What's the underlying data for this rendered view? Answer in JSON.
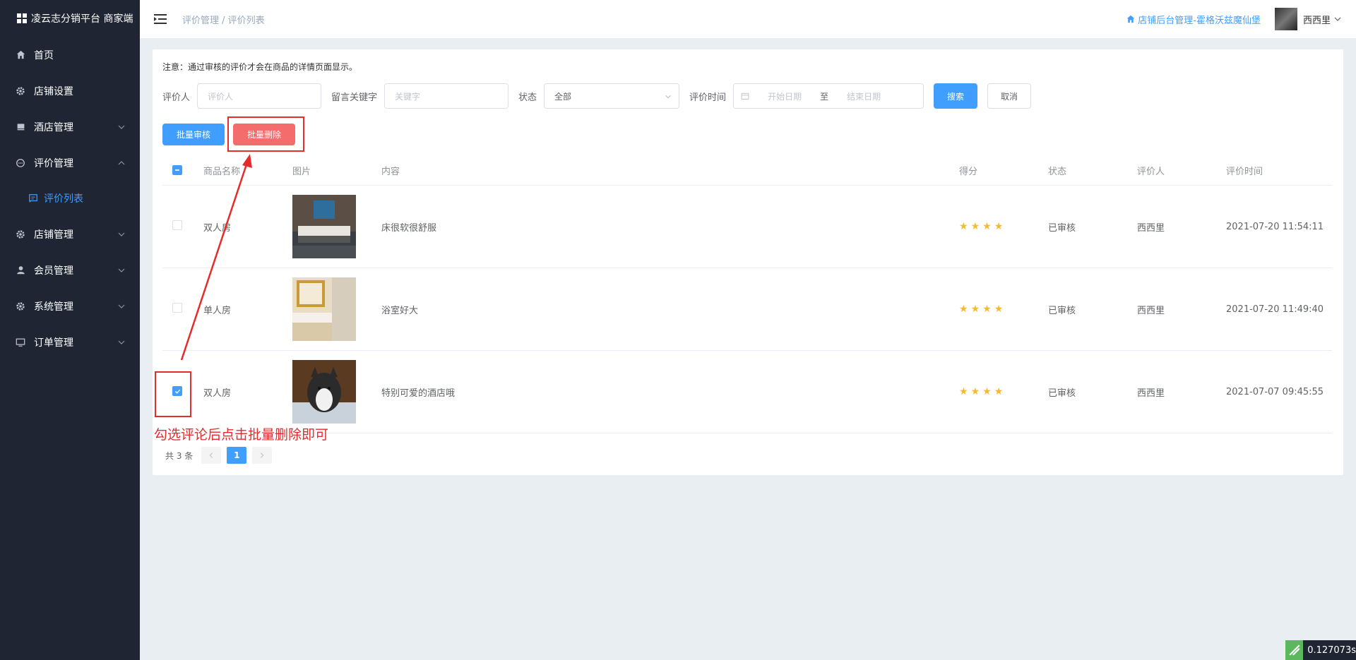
{
  "brand": {
    "title": "凌云志分销平台 商家端"
  },
  "sidebar": {
    "items": [
      {
        "label": "首页",
        "icon": "home-icon"
      },
      {
        "label": "店铺设置",
        "icon": "gear-icon"
      },
      {
        "label": "酒店管理",
        "icon": "bed-icon"
      },
      {
        "label": "评价管理",
        "icon": "comment-icon"
      },
      {
        "label": "评价列表",
        "icon": "comment-list-icon"
      },
      {
        "label": "店铺管理",
        "icon": "gear-icon"
      },
      {
        "label": "会员管理",
        "icon": "user-icon"
      },
      {
        "label": "系统管理",
        "icon": "gear-icon"
      },
      {
        "label": "订单管理",
        "icon": "monitor-icon"
      }
    ]
  },
  "header": {
    "breadcrumb": "评价管理 / 评价列表",
    "store_link": "店铺后台管理-霍格沃兹魔仙堡",
    "username": "西西里"
  },
  "notice": "注意：通过审核的评价才会在商品的详情页面显示。",
  "filters": {
    "reviewer_label": "评价人",
    "reviewer_placeholder": "评价人",
    "keyword_label": "留言关键字",
    "keyword_placeholder": "关键字",
    "status_label": "状态",
    "status_value": "全部",
    "time_label": "评价时间",
    "start_placeholder": "开始日期",
    "range_sep": "至",
    "end_placeholder": "结束日期",
    "search_label": "搜索",
    "cancel_label": "取消"
  },
  "batch": {
    "approve_label": "批量审核",
    "delete_label": "批量删除"
  },
  "table": {
    "headers": {
      "name": "商品名称",
      "image": "图片",
      "content": "内容",
      "score": "得分",
      "status": "状态",
      "reviewer": "评价人",
      "time": "评价时间"
    },
    "rows": [
      {
        "name": "双人房",
        "content": "床很软很舒服",
        "rating": 4,
        "status": "已审核",
        "reviewer": "西西里",
        "time": "2021-07-20 11:54:11",
        "checked": false,
        "image": "bedroom-photo"
      },
      {
        "name": "单人房",
        "content": "浴室好大",
        "rating": 4,
        "status": "已审核",
        "reviewer": "西西里",
        "time": "2021-07-20 11:49:40",
        "checked": false,
        "image": "bathroom-photo"
      },
      {
        "name": "双人房",
        "content": "特别可爱的酒店哦",
        "rating": 4,
        "status": "已审核",
        "reviewer": "西西里",
        "time": "2021-07-07 09:45:55",
        "checked": true,
        "image": "dog-photo"
      }
    ]
  },
  "pager": {
    "total": "共 3 条",
    "current": "1"
  },
  "annotation": {
    "text": "勾选评论后点击批量删除即可"
  },
  "timer": "0.127073s",
  "colors": {
    "primary": "#409eff",
    "danger": "#f56c6c",
    "sidebar": "#1f2532",
    "annotation": "#e52b2b",
    "star": "#f7ba2a"
  }
}
